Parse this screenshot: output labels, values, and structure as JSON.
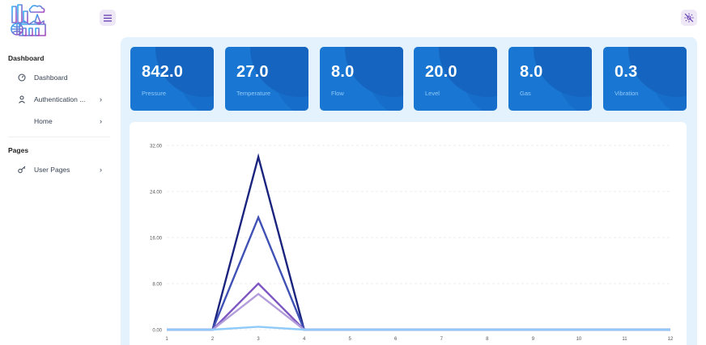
{
  "sidebar": {
    "sections": [
      {
        "caption": "Dashboard"
      },
      {
        "caption": "Pages"
      }
    ],
    "items": [
      {
        "label": "Dashboard",
        "icon": "dashboard-icon"
      },
      {
        "label": "Authentication ...",
        "icon": "user-icon"
      },
      {
        "label": "Home",
        "icon": ""
      },
      {
        "label": "User Pages",
        "icon": "key-icon"
      }
    ]
  },
  "cards": [
    {
      "value": "842.0",
      "label": "Pressure"
    },
    {
      "value": "27.0",
      "label": "Temperature"
    },
    {
      "value": "8.0",
      "label": "Flow"
    },
    {
      "value": "20.0",
      "label": "Level"
    },
    {
      "value": "8.0",
      "label": "Gas"
    },
    {
      "value": "0.3",
      "label": "Vibration"
    }
  ],
  "colors": {
    "accent": "#5e35b1",
    "accent_light": "#ede7f6",
    "card_blue": "#1976d2",
    "main_bg": "#e3f2fd"
  },
  "chart_data": {
    "type": "line",
    "x": [
      1,
      2,
      3,
      4,
      5,
      6,
      7,
      8,
      9,
      10,
      11,
      12
    ],
    "ylim": [
      0,
      32
    ],
    "yticks": [
      "0.00",
      "8.00",
      "16.00",
      "24.00",
      "32.00"
    ],
    "xticks": [
      "1",
      "2",
      "3",
      "4",
      "5",
      "6",
      "7",
      "8",
      "9",
      "10",
      "11",
      "12"
    ],
    "grid": true,
    "series": [
      {
        "color": "#1a237e",
        "values": [
          0,
          0,
          30,
          0,
          0,
          0,
          0,
          0,
          0,
          0,
          0,
          0
        ]
      },
      {
        "color": "#3f51b5",
        "values": [
          0,
          0,
          19.5,
          0,
          0,
          0,
          0,
          0,
          0,
          0,
          0,
          0
        ]
      },
      {
        "color": "#7e57c2",
        "values": [
          0,
          0,
          8,
          0,
          0,
          0,
          0,
          0,
          0,
          0,
          0,
          0
        ]
      },
      {
        "color": "#b39ddb",
        "values": [
          0,
          0,
          6.2,
          0,
          0,
          0,
          0,
          0,
          0,
          0,
          0,
          0
        ]
      },
      {
        "color": "#90caf9",
        "values": [
          0,
          0,
          0.5,
          0,
          0,
          0,
          0,
          0,
          0,
          0,
          0,
          0
        ]
      }
    ]
  }
}
